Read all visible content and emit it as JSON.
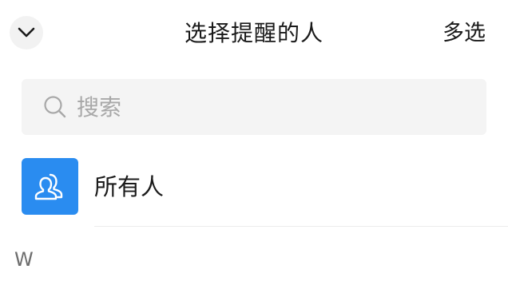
{
  "header": {
    "title": "选择提醒的人",
    "multi_select_label": "多选",
    "collapse_icon": "chevron-down-icon"
  },
  "search": {
    "placeholder": "搜索",
    "value": "",
    "icon": "search-icon"
  },
  "everyone": {
    "label": "所有人",
    "icon": "group-icon",
    "avatar_color": "#2a8cf0"
  },
  "section": {
    "index_letter": "W"
  }
}
